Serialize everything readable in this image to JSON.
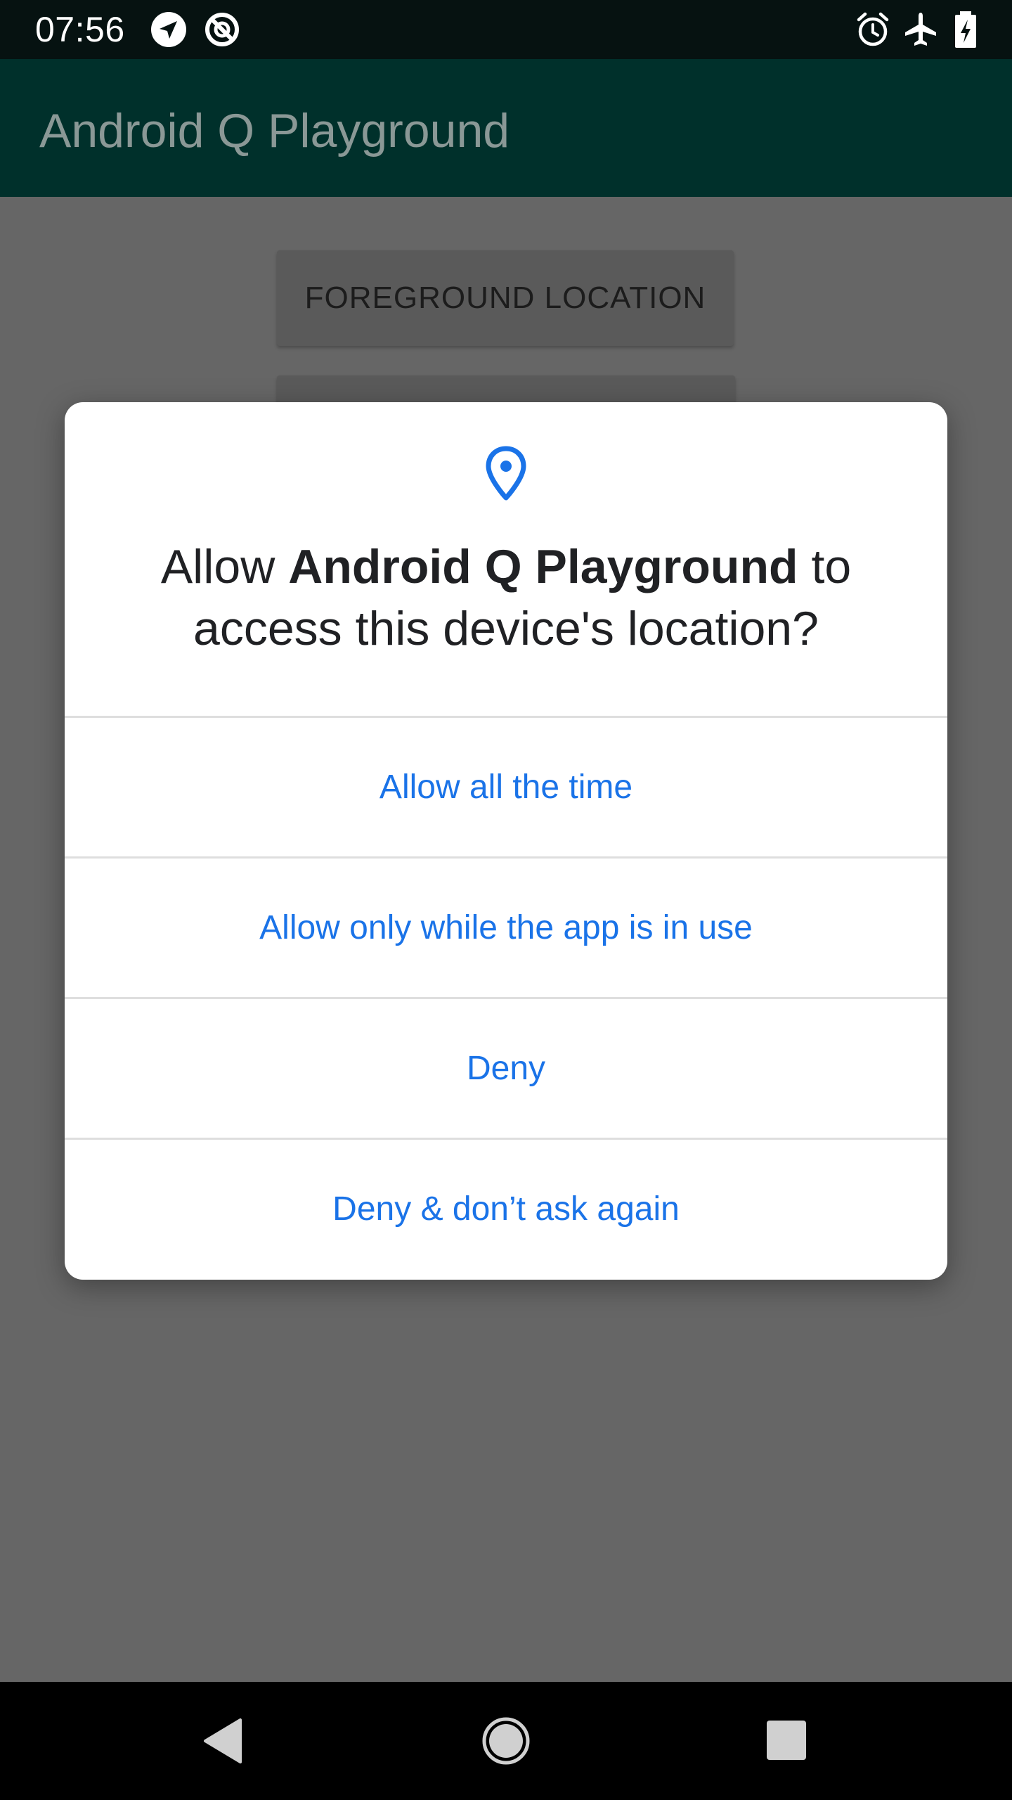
{
  "status_bar": {
    "time": "07:56",
    "left_icons": [
      "navigation-arrow-icon",
      "data-saver-icon"
    ],
    "right_icons": [
      "alarm-icon",
      "airplane-mode-icon",
      "battery-charging-icon"
    ]
  },
  "app_bar": {
    "title": "Android Q Playground"
  },
  "content": {
    "foreground_location_button": "FOREGROUND LOCATION"
  },
  "dialog": {
    "icon": "location-pin-icon",
    "title_prefix": "Allow ",
    "title_app": "Android Q Playground",
    "title_suffix": " to access this device's location?",
    "options": [
      {
        "label": "Allow all the time"
      },
      {
        "label": "Allow only while the app is in use"
      },
      {
        "label": "Deny"
      },
      {
        "label": "Deny & don’t ask again"
      }
    ]
  },
  "nav_bar": {
    "buttons": [
      "back-icon",
      "home-icon",
      "recents-icon"
    ]
  },
  "colors": {
    "accent": "#1a73e8",
    "app_bar": "#00302b",
    "scrim_background": "#666666"
  }
}
